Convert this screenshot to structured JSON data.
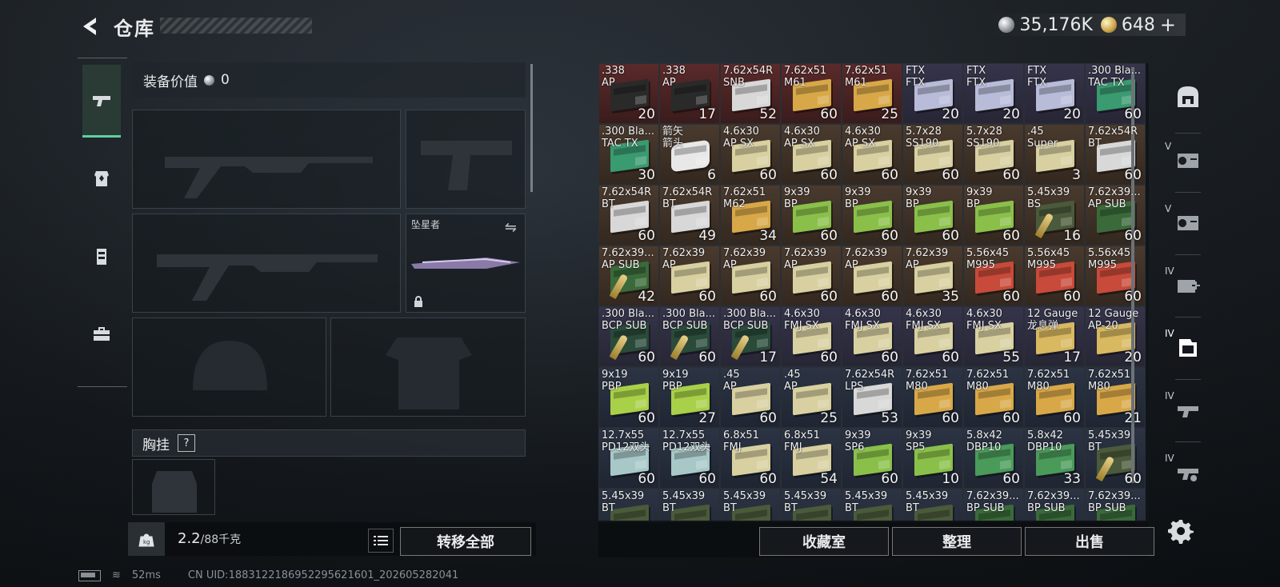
{
  "header": {
    "title": "仓库",
    "silver_amount": "35,176K",
    "gold_amount": "648",
    "gold_add": "+"
  },
  "left": {
    "equip_value_label": "装备价值",
    "equip_value": "0",
    "melee_name": "坠星者",
    "chest_rig_label": "胸挂",
    "chest_rig_help": "?",
    "weight_value": "2.2",
    "weight_capacity": "/88千克",
    "transfer_all": "转移全部"
  },
  "right_buttons": {
    "collection": "收藏室",
    "sort": "整理",
    "sell": "出售"
  },
  "side_levels": [
    "",
    "V",
    "V",
    "IV",
    "IV",
    "IV",
    "IV"
  ],
  "status": {
    "ping": "52ms",
    "uid": "CN UID:1883122186952295621601_202605282041"
  },
  "colors": {
    "active_tab": "#5fd0a0",
    "red_bg": "#5a2a2a",
    "brown_bg": "#4a3a2e",
    "purple_bg": "#35344a",
    "blue_bg": "#2c3444"
  },
  "inventory": [
    {
      "name": ".338\nAP",
      "count": "20",
      "bg": "red",
      "box": "#2a2a2a"
    },
    {
      "name": ".338\nAP",
      "count": "17",
      "bg": "red",
      "box": "#2a2a2a"
    },
    {
      "name": "7.62x54R\nSNB",
      "count": "52",
      "bg": "red",
      "box": "#d8d8d8"
    },
    {
      "name": "7.62x51\nM61",
      "count": "60",
      "bg": "red",
      "box": "#d8a848"
    },
    {
      "name": "7.62x51\nM61",
      "count": "25",
      "bg": "red",
      "box": "#d8a848"
    },
    {
      "name": "FTX\nFTX",
      "count": "20",
      "bg": "purple",
      "box": "#b8bcd8"
    },
    {
      "name": "FTX\nFTX",
      "count": "20",
      "bg": "purple",
      "box": "#b8bcd8"
    },
    {
      "name": "FTX\nFTX",
      "count": "20",
      "bg": "purple",
      "box": "#b8bcd8"
    },
    {
      "name": ".300 Bla...\nTAC TX",
      "count": "60",
      "bg": "purple",
      "box": "#3a9a70"
    },
    {
      "name": ".300 Bla...\nTAC TX",
      "count": "30",
      "bg": "brown",
      "box": "#3a9a70"
    },
    {
      "name": "箭矢\n箭头",
      "count": "6",
      "bg": "brown",
      "box": "#e8e8e8",
      "round": true
    },
    {
      "name": "4.6x30\nAP SX",
      "count": "60",
      "bg": "brown",
      "box": "#d8d0a0"
    },
    {
      "name": "4.6x30\nAP SX",
      "count": "60",
      "bg": "brown",
      "box": "#d8d0a0"
    },
    {
      "name": "4.6x30\nAP SX",
      "count": "60",
      "bg": "brown",
      "box": "#d8d0a0"
    },
    {
      "name": "5.7x28\nSS190",
      "count": "60",
      "bg": "brown",
      "box": "#d8d0a0"
    },
    {
      "name": "5.7x28\nSS190",
      "count": "60",
      "bg": "brown",
      "box": "#d8d0a0"
    },
    {
      "name": ".45\nSuper",
      "count": "3",
      "bg": "brown",
      "box": "#d8d0a0"
    },
    {
      "name": "7.62x54R\nBT",
      "count": "60",
      "bg": "brown",
      "box": "#d8d8d8"
    },
    {
      "name": "7.62x54R\nBT",
      "count": "60",
      "bg": "brown",
      "box": "#d8d8d8"
    },
    {
      "name": "7.62x54R\nBT",
      "count": "49",
      "bg": "brown",
      "box": "#d8d8d8"
    },
    {
      "name": "7.62x51\nM62",
      "count": "34",
      "bg": "brown",
      "box": "#d8a848"
    },
    {
      "name": "9x39\nBP",
      "count": "60",
      "bg": "brown",
      "box": "#8ac04a"
    },
    {
      "name": "9x39\nBP",
      "count": "60",
      "bg": "brown",
      "box": "#8ac04a"
    },
    {
      "name": "9x39\nBP",
      "count": "60",
      "bg": "brown",
      "box": "#8ac04a"
    },
    {
      "name": "9x39\nBP",
      "count": "60",
      "bg": "brown",
      "box": "#8ac04a"
    },
    {
      "name": "5.45x39\nBS",
      "count": "16",
      "bg": "brown",
      "box": "#4a5a3a",
      "bullet": true
    },
    {
      "name": "7.62x39...\nAP SUB",
      "count": "60",
      "bg": "brown",
      "box": "#3a6a3a"
    },
    {
      "name": "7.62x39...\nAP SUB",
      "count": "42",
      "bg": "brown",
      "box": "#3a6a3a",
      "bullet": true
    },
    {
      "name": "7.62x39\nAP",
      "count": "60",
      "bg": "brown",
      "box": "#d8d0a0"
    },
    {
      "name": "7.62x39\nAP",
      "count": "60",
      "bg": "brown",
      "box": "#d8d0a0"
    },
    {
      "name": "7.62x39\nAP",
      "count": "60",
      "bg": "brown",
      "box": "#d8d0a0"
    },
    {
      "name": "7.62x39\nAP",
      "count": "60",
      "bg": "brown",
      "box": "#d8d0a0"
    },
    {
      "name": "7.62x39\nAP",
      "count": "35",
      "bg": "brown",
      "box": "#d8d0a0"
    },
    {
      "name": "5.56x45\nM995",
      "count": "60",
      "bg": "brown",
      "box": "#c84a3a"
    },
    {
      "name": "5.56x45\nM995",
      "count": "60",
      "bg": "brown",
      "box": "#c84a3a"
    },
    {
      "name": "5.56x45\nM995",
      "count": "60",
      "bg": "brown",
      "box": "#c84a3a"
    },
    {
      "name": ".300 Bla...\nBCP SUB",
      "count": "60",
      "bg": "purple",
      "box": "#2a4a3a",
      "bullet": true
    },
    {
      "name": ".300 Bla...\nBCP SUB",
      "count": "60",
      "bg": "purple",
      "box": "#2a4a3a",
      "bullet": true
    },
    {
      "name": ".300 Bla...\nBCP SUB",
      "count": "17",
      "bg": "purple",
      "box": "#2a4a3a",
      "bullet": true
    },
    {
      "name": "4.6x30\nFMJ SX",
      "count": "60",
      "bg": "purple",
      "box": "#d8d0a0"
    },
    {
      "name": "4.6x30\nFMJ SX",
      "count": "60",
      "bg": "purple",
      "box": "#d8d0a0"
    },
    {
      "name": "4.6x30\nFMJ SX",
      "count": "60",
      "bg": "purple",
      "box": "#d8d0a0"
    },
    {
      "name": "4.6x30\nFMJ SX",
      "count": "55",
      "bg": "purple",
      "box": "#d8d0a0"
    },
    {
      "name": "12 Gauge\n龙息弹",
      "count": "17",
      "bg": "purple",
      "box": "#d8b860"
    },
    {
      "name": "12 Gauge\nAP-20",
      "count": "20",
      "bg": "purple",
      "box": "#d8b860"
    },
    {
      "name": "9x19\nPBP",
      "count": "60",
      "bg": "blue",
      "box": "#a8d048"
    },
    {
      "name": "9x19\nPBP",
      "count": "27",
      "bg": "blue",
      "box": "#a8d048"
    },
    {
      "name": ".45\nAP",
      "count": "60",
      "bg": "blue",
      "box": "#d8d0a0"
    },
    {
      "name": ".45\nAP",
      "count": "25",
      "bg": "blue",
      "box": "#d8d0a0"
    },
    {
      "name": "7.62x54R\nLPS",
      "count": "53",
      "bg": "blue",
      "box": "#d8d8d8"
    },
    {
      "name": "7.62x51\nM80",
      "count": "60",
      "bg": "blue",
      "box": "#d8a848"
    },
    {
      "name": "7.62x51\nM80",
      "count": "60",
      "bg": "blue",
      "box": "#d8a848"
    },
    {
      "name": "7.62x51\nM80",
      "count": "60",
      "bg": "blue",
      "box": "#d8a848"
    },
    {
      "name": "7.62x51\nM80",
      "count": "21",
      "bg": "blue",
      "box": "#d8a848"
    },
    {
      "name": "12.7x55\nPD12双头",
      "count": "60",
      "bg": "blue",
      "box": "#a8c8c8"
    },
    {
      "name": "12.7x55\nPD12双头",
      "count": "60",
      "bg": "blue",
      "box": "#a8c8c8"
    },
    {
      "name": "6.8x51\nFMJ",
      "count": "60",
      "bg": "blue",
      "box": "#d8d0a0"
    },
    {
      "name": "6.8x51\nFMJ",
      "count": "54",
      "bg": "blue",
      "box": "#d8d0a0"
    },
    {
      "name": "9x39\nSP6",
      "count": "60",
      "bg": "blue",
      "box": "#8ac04a"
    },
    {
      "name": "9x39\nSP5",
      "count": "10",
      "bg": "blue",
      "box": "#8ac04a"
    },
    {
      "name": "5.8x42\nDBP10",
      "count": "60",
      "bg": "blue",
      "box": "#4a9a5a"
    },
    {
      "name": "5.8x42\nDBP10",
      "count": "33",
      "bg": "blue",
      "box": "#4a9a5a"
    },
    {
      "name": "5.45x39\nBT",
      "count": "60",
      "bg": "blue",
      "box": "#4a5a3a",
      "bullet": true
    },
    {
      "name": "5.45x39\nBT",
      "count": "",
      "bg": "blue",
      "box": "#4a5a3a"
    },
    {
      "name": "5.45x39\nBT",
      "count": "",
      "bg": "blue",
      "box": "#4a5a3a"
    },
    {
      "name": "5.45x39\nBT",
      "count": "",
      "bg": "blue",
      "box": "#4a5a3a"
    },
    {
      "name": "5.45x39\nBT",
      "count": "",
      "bg": "blue",
      "box": "#4a5a3a"
    },
    {
      "name": "5.45x39\nBT",
      "count": "",
      "bg": "blue",
      "box": "#4a5a3a"
    },
    {
      "name": "5.45x39\nBT",
      "count": "",
      "bg": "blue",
      "box": "#4a5a3a"
    },
    {
      "name": "7.62x39...\nBP SUB",
      "count": "",
      "bg": "blue",
      "box": "#3a6a3a"
    },
    {
      "name": "7.62x39...\nBP SUB",
      "count": "",
      "bg": "blue",
      "box": "#3a6a3a"
    },
    {
      "name": "7.62x39...\nBP SUB",
      "count": "",
      "bg": "blue",
      "box": "#3a6a3a"
    }
  ]
}
